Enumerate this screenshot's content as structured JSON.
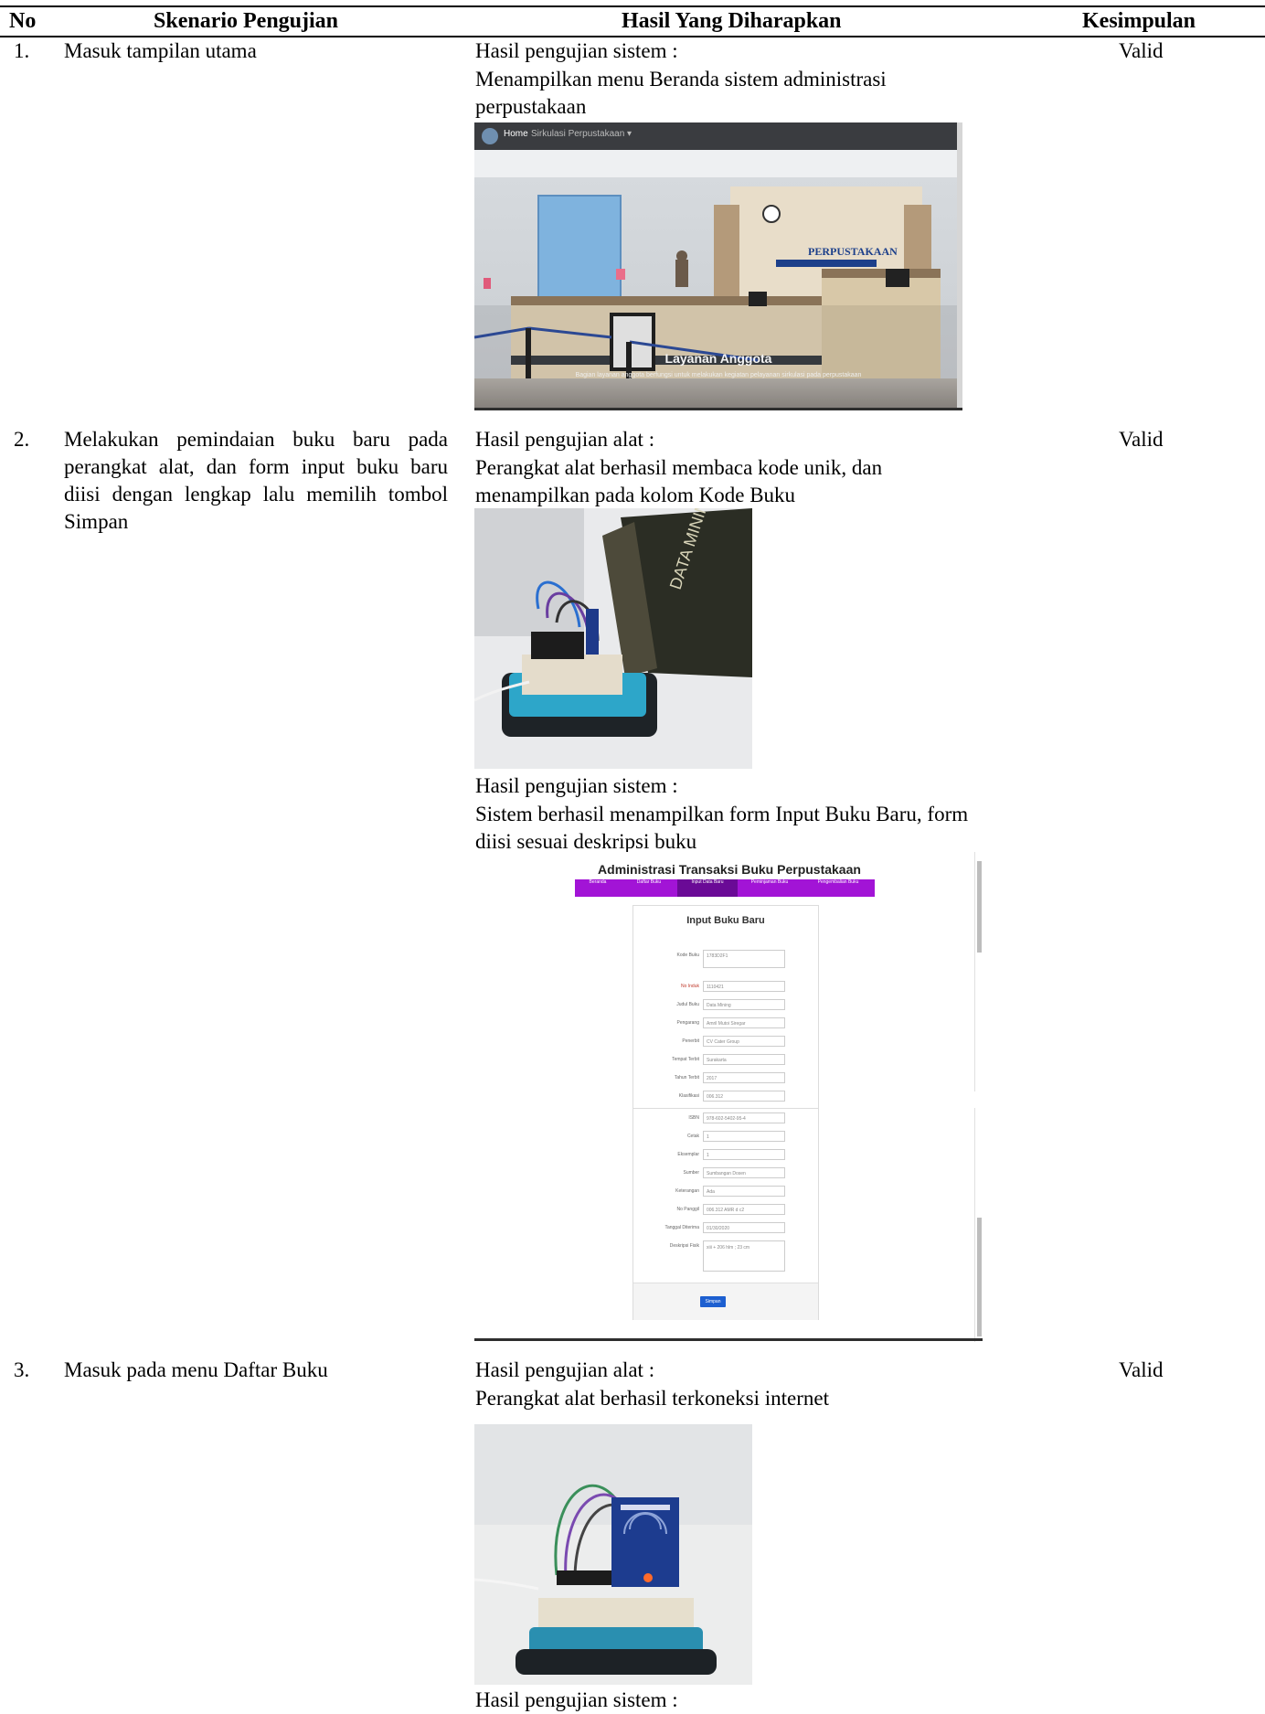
{
  "header": {
    "no": "No",
    "scenario": "Skenario Pengujian",
    "expected": "Hasil Yang Diharapkan",
    "conclusion": "Kesimpulan"
  },
  "rows": [
    {
      "no": "1.",
      "scenario": "Masuk tampilan utama",
      "results": [
        {
          "title": "Hasil pengujian sistem :",
          "desc": "Menampilkan menu Beranda sistem administrasi perpustakaan"
        }
      ],
      "conclusion": "Valid"
    },
    {
      "no": "2.",
      "scenario": "Melakukan pemindaian buku baru pada perangkat alat, dan form input buku baru diisi dengan lengkap lalu memilih tombol Simpan",
      "results": [
        {
          "title": "Hasil pengujian alat :",
          "desc": "Perangkat alat berhasil membaca kode unik, dan menampilkan pada kolom Kode Buku"
        },
        {
          "title": "Hasil pengujian sistem :",
          "desc": "Sistem berhasil menampilkan form Input Buku Baru, form diisi sesuai deskripsi buku"
        }
      ],
      "conclusion": "Valid"
    },
    {
      "no": "3.",
      "scenario": "Masuk pada menu Daftar Buku",
      "results": [
        {
          "title": "Hasil pengujian alat :",
          "desc": "Perangkat alat berhasil terkoneksi internet"
        },
        {
          "title": "Hasil pengujian sistem :"
        }
      ],
      "conclusion": "Valid"
    }
  ],
  "screenshot_home": {
    "nav_home": "Home",
    "nav_menu": "Sirkulasi Perpustakaan ▾",
    "sign": "PERPUSTAKAAN",
    "caption": "Layanan Anggota",
    "subcaption": "Bagian layanan anggota berfungsi untuk melakukan kegiatan pelayanan sirkulasi pada perpustakaan"
  },
  "photo_book": {
    "cover": "DATA MINING"
  },
  "screenshot_form": {
    "title": "Administrasi Transaksi Buku Perpustakaan",
    "tabs": [
      "Beranda",
      "Daftar Buku",
      "Input Data Baru",
      "Peminjaman Buku",
      "Pengembalian Buku"
    ],
    "card_title": "Input Buku Baru",
    "fields_top": [
      {
        "label": "Kode Buku",
        "value": "1783D2F1"
      },
      {
        "label": "No Induk",
        "value": "1110421"
      },
      {
        "label": "Judul Buku",
        "value": "Data Mining"
      },
      {
        "label": "Pengarang",
        "value": "Amril Mutoi Siregar"
      },
      {
        "label": "Penerbit",
        "value": "CV Cater Group"
      },
      {
        "label": "Tempat Terbit",
        "value": "Surakarta"
      },
      {
        "label": "Tahun Terbit",
        "value": "2017"
      },
      {
        "label": "Klasifikasi",
        "value": "006.312"
      }
    ],
    "fields_bottom": [
      {
        "label": "ISBN",
        "value": "978-602-5402-95-4"
      },
      {
        "label": "Cetak",
        "value": "1"
      },
      {
        "label": "Eksemplar",
        "value": "1"
      },
      {
        "label": "Sumber",
        "value": "Sumbangan Dosen"
      },
      {
        "label": "Keterangan",
        "value": "Ada"
      },
      {
        "label": "No Panggil",
        "value": "006.312 AMR d c2"
      },
      {
        "label": "Tanggal Diterima",
        "value": "01/30/2020"
      },
      {
        "label": "Deskripsi Fisik",
        "value": "xiii + 206 hlm ; 23 cm"
      }
    ],
    "save": "Simpan"
  }
}
